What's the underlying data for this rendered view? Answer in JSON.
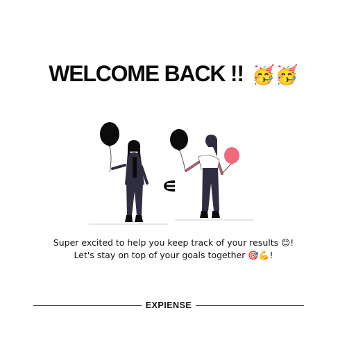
{
  "header": {
    "title": "WELCOME BACK !!",
    "emoji": "🥳🥳"
  },
  "illustration": {
    "logo_icon": "expiense-e-logo-icon",
    "colors": {
      "balloon_dark": "#0c0c0c",
      "balloon_accent": "#f06a7e",
      "outfit": "#2f2e41",
      "top_white": "#ffffff",
      "skin": "#a0616a",
      "ground": "#cfcfcf"
    }
  },
  "message": {
    "line1": "Super excited to help you keep track of your results 😊!",
    "line2": "Let's stay on top of your goals together 🎯💪!"
  },
  "footer": {
    "brand": "EXPIENSE"
  }
}
